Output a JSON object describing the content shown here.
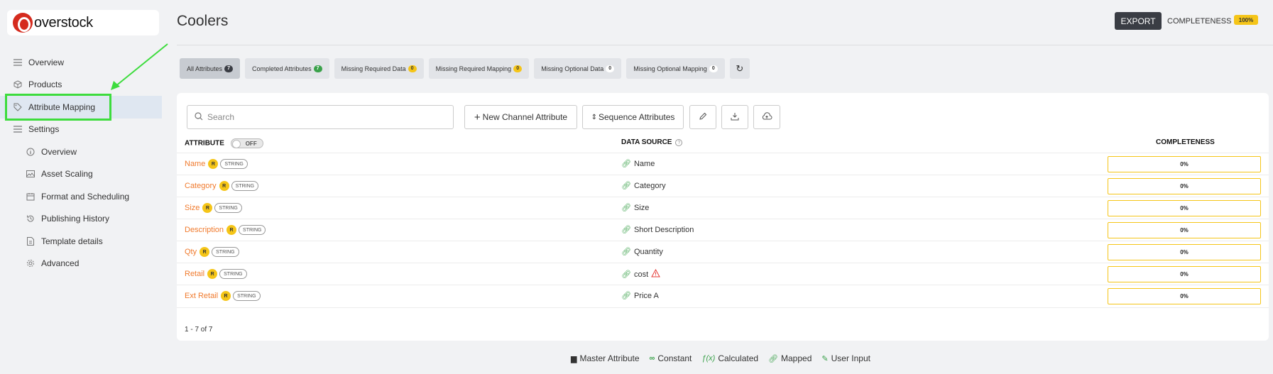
{
  "brand": {
    "logo_text": "overstock"
  },
  "sidebar": {
    "items": [
      {
        "label": "Overview",
        "icon": "menu-icon"
      },
      {
        "label": "Products",
        "icon": "box-icon"
      },
      {
        "label": "Attribute Mapping",
        "icon": "tag-icon",
        "active": true
      },
      {
        "label": "Settings",
        "icon": "menu-icon"
      },
      {
        "label": "Overview",
        "icon": "info-icon"
      },
      {
        "label": "Asset Scaling",
        "icon": "image-icon"
      },
      {
        "label": "Format and Scheduling",
        "icon": "calendar-icon"
      },
      {
        "label": "Publishing History",
        "icon": "history-icon"
      },
      {
        "label": "Template details",
        "icon": "document-icon"
      },
      {
        "label": "Advanced",
        "icon": "gear-icon"
      }
    ]
  },
  "header": {
    "title": "Coolers",
    "export_label": "EXPORT",
    "completeness_label": "COMPLETENESS",
    "completeness_value": "100%"
  },
  "tabs": [
    {
      "label": "All Attributes",
      "count": "7",
      "style": "dark"
    },
    {
      "label": "Completed Attributes",
      "count": "7",
      "style": "green"
    },
    {
      "label": "Missing Required Data",
      "count": "0",
      "style": "yellow"
    },
    {
      "label": "Missing Required Mapping",
      "count": "0",
      "style": "yellow"
    },
    {
      "label": "Missing Optional Data",
      "count": "0",
      "style": "white"
    },
    {
      "label": "Missing Optional Mapping",
      "count": "0",
      "style": "white"
    }
  ],
  "toolbar": {
    "search_placeholder": "Search",
    "new_channel_label": "New Channel Attribute",
    "sequence_label": "Sequence Attributes"
  },
  "table": {
    "col_attribute": "ATTRIBUTE",
    "toggle_label": "OFF",
    "col_source": "DATA SOURCE",
    "col_completeness": "COMPLETENESS",
    "required_badge": "R",
    "rows": [
      {
        "attribute": "Name",
        "type": "STRING",
        "source": "Name",
        "warning": false,
        "completeness": "0%"
      },
      {
        "attribute": "Category",
        "type": "STRING",
        "source": "Category",
        "warning": false,
        "completeness": "0%"
      },
      {
        "attribute": "Size",
        "type": "STRING",
        "source": "Size",
        "warning": false,
        "completeness": "0%"
      },
      {
        "attribute": "Description",
        "type": "STRING",
        "source": "Short Description",
        "warning": false,
        "completeness": "0%"
      },
      {
        "attribute": "Qty",
        "type": "STRING",
        "source": "Quantity",
        "warning": false,
        "completeness": "0%"
      },
      {
        "attribute": "Retail",
        "type": "STRING",
        "source": "cost",
        "warning": true,
        "completeness": "0%"
      },
      {
        "attribute": "Ext Retail",
        "type": "STRING",
        "source": "Price A",
        "warning": false,
        "completeness": "0%"
      }
    ],
    "pager": "1 - 7 of 7"
  },
  "legend": [
    {
      "label": "Master Attribute",
      "icon": "master-icon",
      "color": "#333333"
    },
    {
      "label": "Constant",
      "icon": "infinity-icon",
      "color": "#3aa14a"
    },
    {
      "label": "Calculated",
      "icon": "function-icon",
      "color": "#3aa14a"
    },
    {
      "label": "Mapped",
      "icon": "link-icon",
      "color": "#3aa14a"
    },
    {
      "label": "User Input",
      "icon": "pencil-icon",
      "color": "#3aa14a"
    }
  ],
  "colors": {
    "accent_orange": "#f07a2d",
    "badge_yellow": "#f5c518",
    "highlight_green": "#3ddc3d"
  }
}
